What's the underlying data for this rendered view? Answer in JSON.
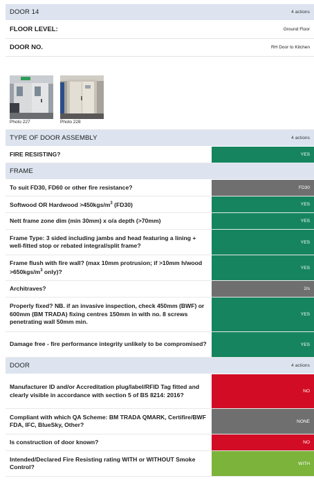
{
  "door_section": {
    "title": "DOOR 14",
    "count": "4 actions"
  },
  "floor_level": {
    "label": "FLOOR LEVEL:",
    "value": "Ground Floor"
  },
  "door_no": {
    "label": "DOOR NO.",
    "value": "RH Door to Kitchen"
  },
  "photos": [
    {
      "caption": "Photo 227"
    },
    {
      "caption": "Photo 228"
    }
  ],
  "assembly_section": {
    "title": "TYPE OF DOOR ASSEMBLY",
    "count": "4 actions"
  },
  "fire_resisting": {
    "question": "FIRE RESISTING?",
    "answer": "YES",
    "color": "#16855f"
  },
  "frame_section": {
    "title": "FRAME"
  },
  "frame_rows": [
    {
      "question": "To suit FD30, FD60 or other fire resistance?",
      "answer": "FD30",
      "status": "grey"
    },
    {
      "question": "Softwood OR Hardwood >450kgs/m³ (FD30)",
      "answer": "YES",
      "status": "green"
    },
    {
      "question": "Nett frame zone dim (min 30mm) x o/a depth (>70mm)",
      "answer": "YES",
      "status": "green"
    },
    {
      "question": "Frame Type: 3 sided including jambs and head featuring a lining + well-fitted stop or rebated integral/split frame?",
      "answer": "YES",
      "status": "green"
    },
    {
      "question": "Frame flush with fire wall? (max 10mm protrusion; if >10mm h/wood >650kgs/m³ only)?",
      "answer": "YES",
      "status": "green"
    },
    {
      "question": "Architraves?",
      "answer": "2/s",
      "status": "grey"
    },
    {
      "question": "Properly fixed?  NB. if an invasive inspection, check 450mm (BWF) or 600mm (BM TRADA) fixing centres 150mm in with no. 8 screws penetrating wall 50mm min.",
      "answer": "YES",
      "status": "green"
    },
    {
      "question": "Damage free - fire performance integrity unlikely to be compromised?",
      "answer": "YES",
      "status": "green"
    }
  ],
  "door_sub_section": {
    "title": "DOOR",
    "count": "4 actions"
  },
  "door_rows": [
    {
      "question": "Manufacturer ID and/or Accreditation plug/label/RFID Tag fitted and clearly visible in accordance with section 5 of BS 8214: 2016?",
      "answer": "NO",
      "status": "red"
    },
    {
      "question": "Compliant with which QA Scheme: BM TRADA QMARK, Certifire/BWF FDA, IFC, BlueSky, Other?",
      "answer": "NONE",
      "status": "grey"
    },
    {
      "question": "Is construction of door known?",
      "answer": "NO",
      "status": "red"
    },
    {
      "question": "Intended/Declared Fire Resisting rating WITH or WITHOUT Smoke Control?",
      "answer": "WITH",
      "status": "lime"
    }
  ],
  "colors": {
    "green": "#16855f",
    "grey": "#6f6f6f",
    "red": "#d10c24",
    "lime": "#7cb33b",
    "section_bg": "#dde4ef"
  }
}
